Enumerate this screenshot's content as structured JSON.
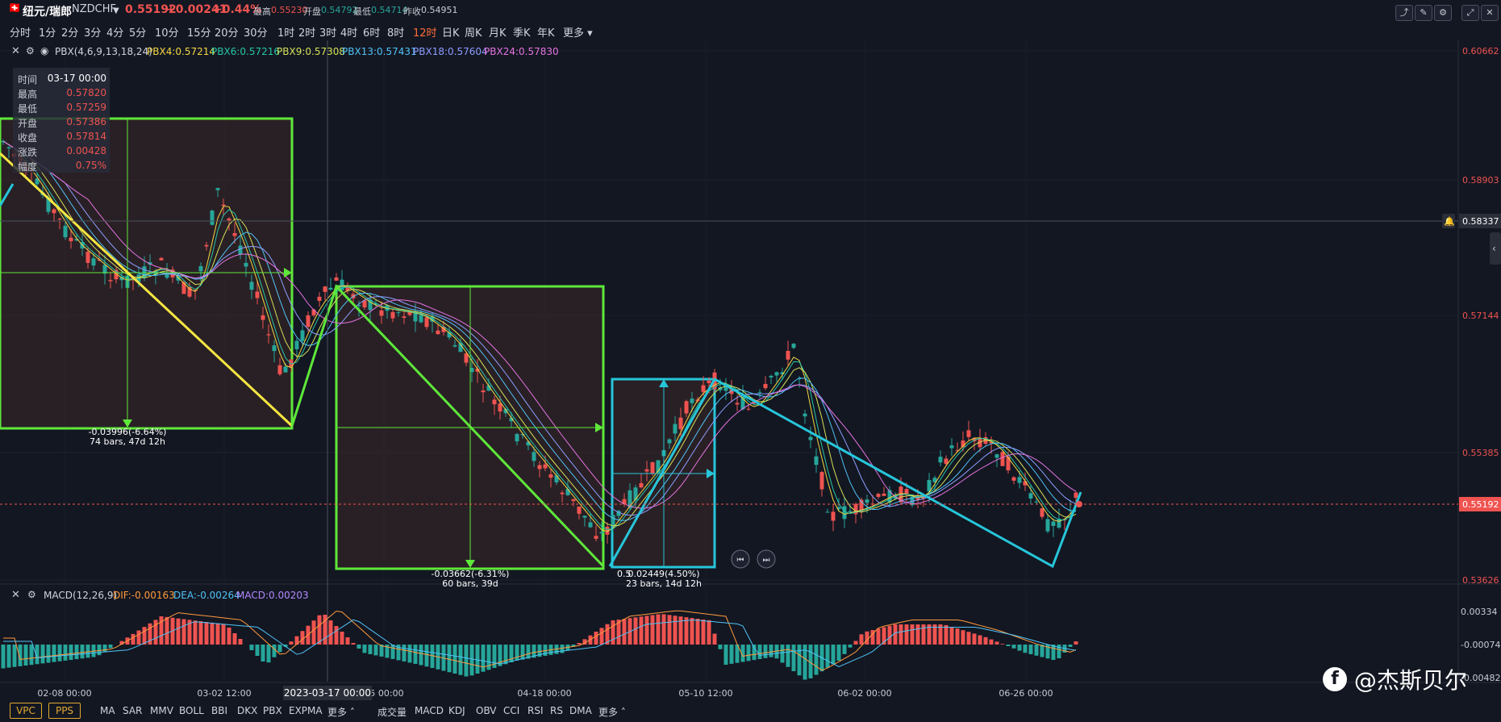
{
  "header": {
    "symbol_name": "纽元/瑞郎",
    "symbol_code": "NZDCHF",
    "price": "0.55192",
    "change": "+0.00241",
    "change_pct": "+0.44%",
    "high_label": "最高",
    "high": "0.55230",
    "open_label": "开盘",
    "open": "0.54792",
    "low_label": "最低",
    "low": "0.54714",
    "prev_label": "昨收",
    "prev": "0.54951"
  },
  "periods": [
    "分时",
    "1分",
    "2分",
    "3分",
    "4分",
    "5分",
    "10分",
    "15分",
    "20分",
    "30分",
    "1时",
    "2时",
    "3时",
    "4时",
    "6时",
    "8时",
    "12时",
    "日K",
    "周K",
    "月K",
    "季K",
    "年K",
    "更多"
  ],
  "active_period": "12时",
  "pbx": {
    "title": "PBX(4,6,9,13,18,24)",
    "items": [
      {
        "label": "PBX4:0.57214",
        "color": "#f5d742"
      },
      {
        "label": "PBX6:0.57216",
        "color": "#26c6a6"
      },
      {
        "label": "PBX9:0.57308",
        "color": "#d4e157"
      },
      {
        "label": "PBX13:0.57431",
        "color": "#4fc3f7"
      },
      {
        "label": "PBX18:0.57604",
        "color": "#8c9eff"
      },
      {
        "label": "PBX24:0.57830",
        "color": "#e573e0"
      }
    ]
  },
  "info_box": {
    "rows": [
      {
        "k": "时间",
        "v": "03-17 00:00"
      },
      {
        "k": "最高",
        "v": "0.57820"
      },
      {
        "k": "最低",
        "v": "0.57259"
      },
      {
        "k": "开盘",
        "v": "0.57386"
      },
      {
        "k": "收盘",
        "v": "0.57814"
      },
      {
        "k": "涨跌",
        "v": "0.00428"
      },
      {
        "k": "幅度",
        "v": "0.75%"
      }
    ]
  },
  "price_axis": [
    "0.60662",
    "0.58903",
    "0.57144",
    "0.55385",
    "0.53626"
  ],
  "crosshair_price": "0.58337",
  "last_price_tag": "0.55192",
  "measurements": [
    {
      "line1": "-0.03996(-6.64%)",
      "line2": "74 bars, 47d 12h"
    },
    {
      "line1": "-0.03662(-6.31%)",
      "line2": "60 bars, 39d"
    },
    {
      "line1": "0.02449(4.50%)",
      "line2": "23 bars, 14d 12h"
    }
  ],
  "overlap_label": "0.5",
  "macd": {
    "title": "MACD(12,26,9)",
    "dif": "DIF:-0.00163",
    "dea": "DEA:-0.00264",
    "macd": "MACD:0.00203",
    "axis": [
      "0.00334",
      "-0.00074",
      "-0.00482"
    ]
  },
  "time_axis": [
    "02-08 00:00",
    "03-02 12:00",
    "25 00:00",
    "04-18 00:00",
    "05-10 12:00",
    "06-02 00:00",
    "06-26 00:00"
  ],
  "crosshair_time": "2023-03-17 00:00",
  "bottom_bar": {
    "pills": [
      "VPC",
      "PPS"
    ],
    "main_inds": [
      "MA",
      "SAR",
      "MMV",
      "BOLL",
      "BBI",
      "DKX",
      "PBX",
      "EXPMA",
      "更多"
    ],
    "sub_inds": [
      "成交量",
      "MACD",
      "KDJ",
      "OBV",
      "CCI",
      "RSI",
      "RS",
      "DMA",
      "更多"
    ]
  },
  "watermark": "@杰斯贝尔",
  "colors": {
    "up": "#ef5350",
    "down": "#26a69a",
    "green_box": "#5ee83a",
    "cyan_box": "#26c6da",
    "yellow_line": "#f5e642"
  }
}
